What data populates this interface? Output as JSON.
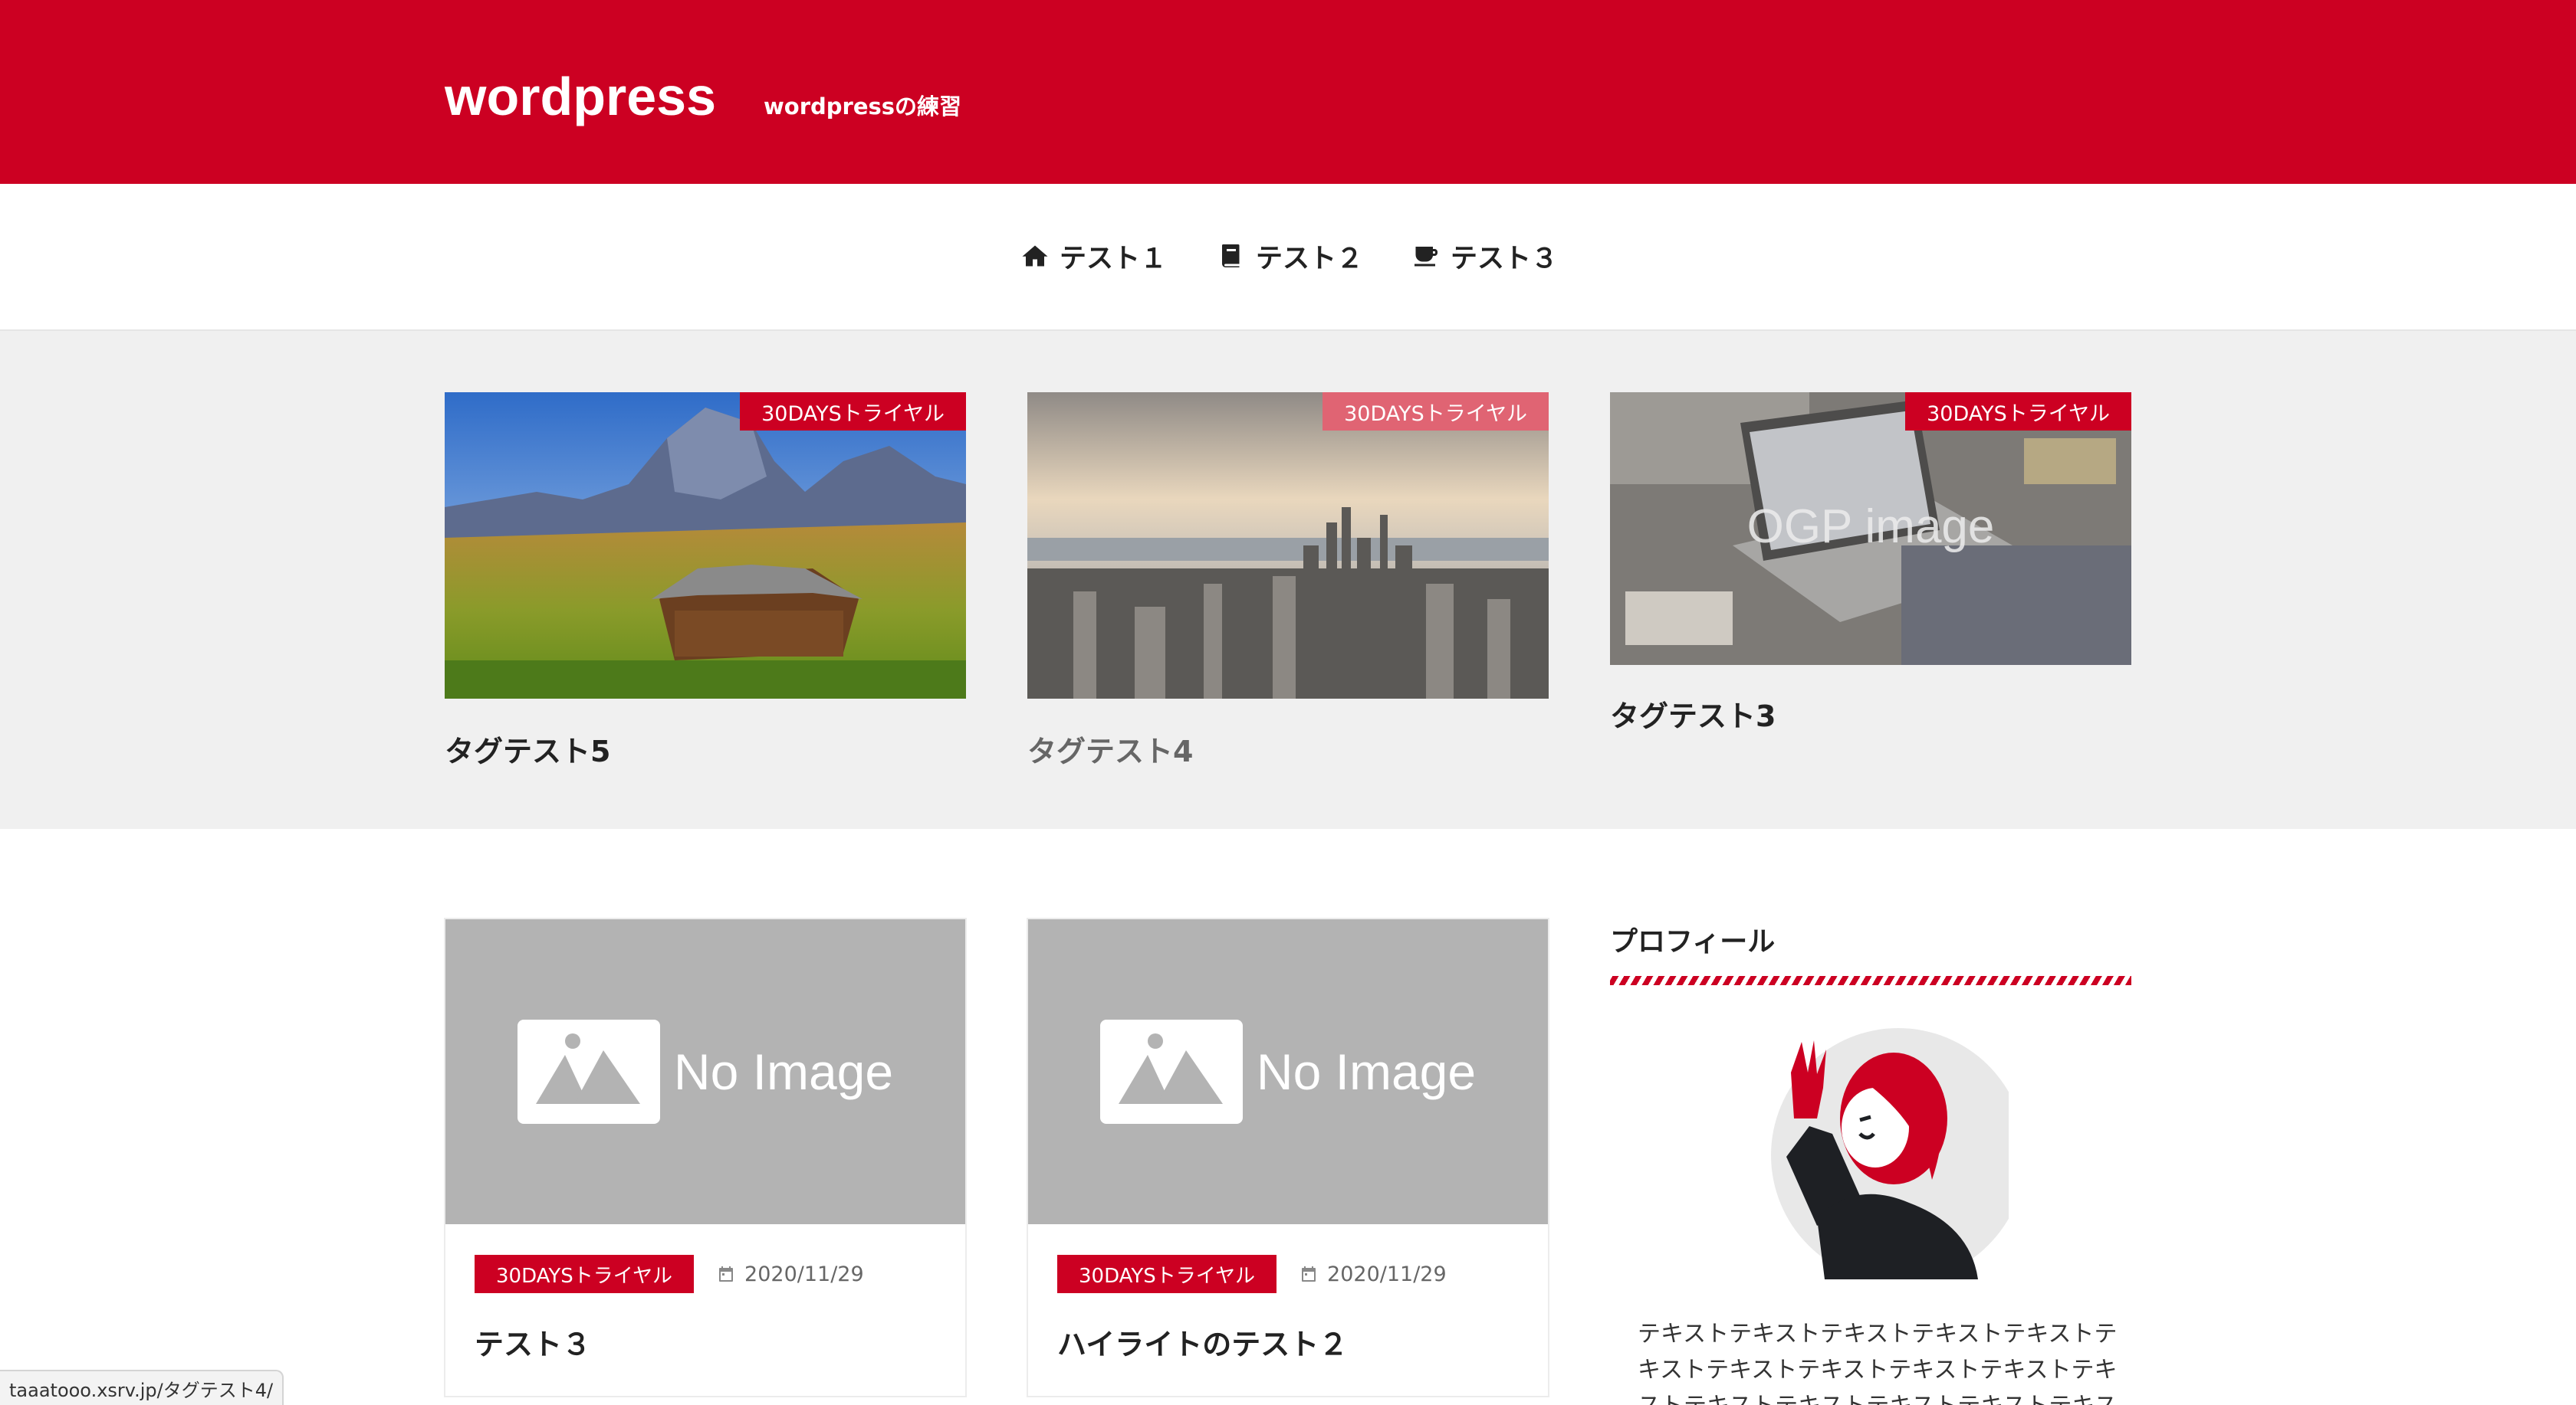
{
  "header": {
    "site_title": "wordpress",
    "tagline": "wordpressの練習"
  },
  "nav": {
    "items": [
      {
        "label": "テスト１",
        "icon": "home-icon"
      },
      {
        "label": "テスト２",
        "icon": "book-icon"
      },
      {
        "label": "テスト３",
        "icon": "coffee-icon"
      }
    ]
  },
  "pickup": [
    {
      "category": "30DAYSトライヤル",
      "title": "タグテスト5",
      "thumbnail": "mountain-hut-photo"
    },
    {
      "category": "30DAYSトライヤル",
      "title": "タグテスト4",
      "thumbnail": "city-skyline-photo"
    },
    {
      "category": "30DAYSトライヤル",
      "title": "タグテスト3",
      "thumbnail": "ogp-image-laptop-photo",
      "overlay_text": "OGP image"
    }
  ],
  "posts": [
    {
      "thumbnail_text": "No Image",
      "category": "30DAYSトライヤル",
      "date": "2020/11/29",
      "title": "テスト３"
    },
    {
      "thumbnail_text": "No Image",
      "category": "30DAYSトライヤル",
      "date": "2020/11/29",
      "title": "ハイライトのテスト２"
    }
  ],
  "sidebar": {
    "profile_title": "プロフィール",
    "profile_text": "テキストテキストテキストテキストテキストテキストテキストテキストテキストテキストテキストテキストテキストテキストテキストテキストテキスト"
  },
  "status_bar": {
    "url": "taaatooo.xsrv.jp/タグテスト4/"
  },
  "colors": {
    "brand": "#cc0022",
    "background_light": "#f0f0f0",
    "no_image_bg": "#b3b3b3"
  }
}
